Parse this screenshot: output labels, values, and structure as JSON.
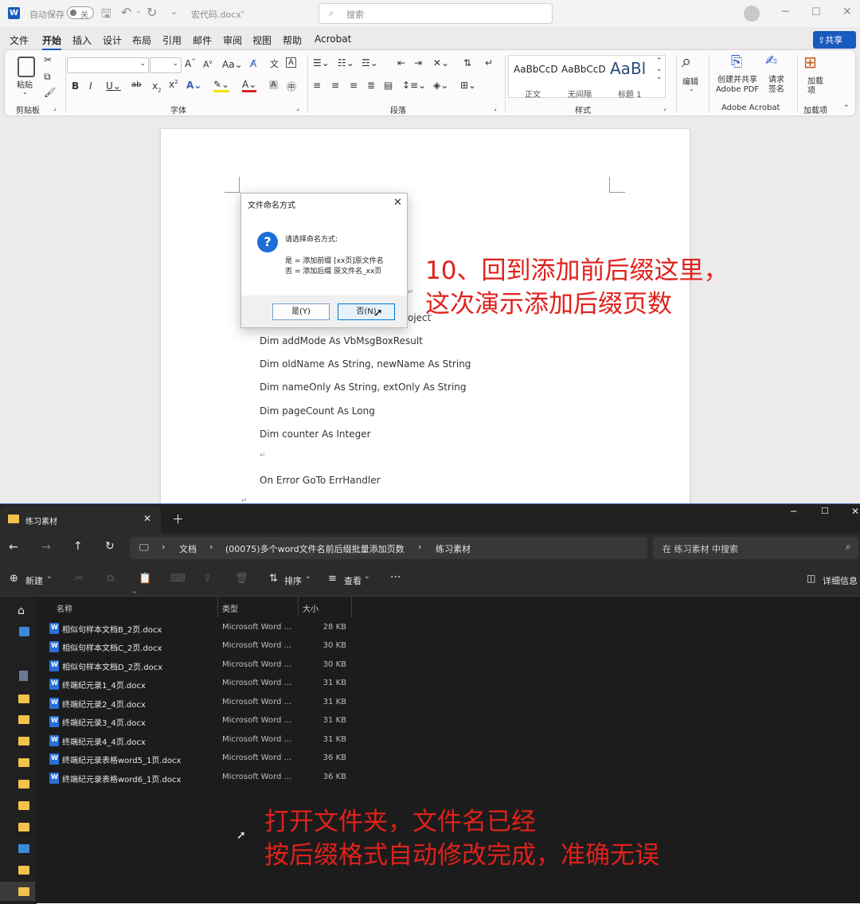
{
  "word": {
    "autosave_label": "自动保存",
    "autosave_state": "关",
    "doc_title": "宏代码.docx",
    "search_placeholder": "搜索",
    "menu": [
      "文件",
      "开始",
      "插入",
      "设计",
      "布局",
      "引用",
      "邮件",
      "审阅",
      "视图",
      "帮助",
      "Acrobat"
    ],
    "share_label": "共享",
    "ribbon": {
      "paste_label": "粘贴",
      "clipboard_label": "剪贴板",
      "font_label": "字体",
      "paragraph_label": "段落",
      "styles_label": "样式",
      "styles": [
        {
          "preview": "AaBbCcD",
          "name": "正文"
        },
        {
          "preview": "AaBbCcD",
          "name": "无间隔"
        },
        {
          "preview": "AaBl",
          "name": "标题 1"
        }
      ],
      "edit_label": "编辑",
      "create_pdf_label": "创建并共享 Adobe PDF",
      "sign_label": "请求签名",
      "adobe_label": "Adobe Acrobat",
      "addins_label": "加载项",
      "addins_icon_label": "加载项"
    },
    "code_lines": [
      "Dim addMode As VbMsgBoxResult",
      "Dim oldName As String, newName As String",
      "Dim nameOnly As String, extOnly As String",
      "Dim pageCount As Long",
      "Dim counter As Integer",
      "",
      "On Error GoTo ErrHandler"
    ],
    "code_partial": "oject"
  },
  "dialog": {
    "title": "文件命名方式",
    "prompt": "请选择命名方式:",
    "option_yes": "是 = 添加前缀 [xx页]原文件名",
    "option_no": "否 = 添加后缀 原文件名_xx页",
    "yes_button": "是(Y)",
    "no_button": "否(N)"
  },
  "annotations": {
    "top_line1": "10、回到添加前后缀这里，",
    "top_line2": "这次演示添加后缀页数",
    "bottom_line1": "打开文件夹，文件名已经",
    "bottom_line2": "按后缀格式自动修改完成，准确无误"
  },
  "explorer": {
    "tab_title": "练习素材",
    "breadcrumb": [
      "文档",
      "(00075)多个word文件名前后缀批量添加页数",
      "练习素材"
    ],
    "search_placeholder": "在 练习素材 中搜索",
    "new_label": "新建",
    "sort_label": "排序",
    "view_label": "查看",
    "details_label": "详细信息",
    "columns": {
      "name": "名称",
      "type": "类型",
      "size": "大小"
    },
    "files": [
      {
        "name": "相似句样本文档B_2页.docx",
        "type": "Microsoft Word ...",
        "size": "28 KB"
      },
      {
        "name": "相似句样本文档C_2页.docx",
        "type": "Microsoft Word ...",
        "size": "30 KB"
      },
      {
        "name": "相似句样本文档D_2页.docx",
        "type": "Microsoft Word ...",
        "size": "30 KB"
      },
      {
        "name": "终端纪元录1_4页.docx",
        "type": "Microsoft Word ...",
        "size": "31 KB"
      },
      {
        "name": "终端纪元录2_4页.docx",
        "type": "Microsoft Word ...",
        "size": "31 KB"
      },
      {
        "name": "终端纪元录3_4页.docx",
        "type": "Microsoft Word ...",
        "size": "31 KB"
      },
      {
        "name": "终端纪元录4_4页.docx",
        "type": "Microsoft Word ...",
        "size": "31 KB"
      },
      {
        "name": "终端纪元录表格word5_1页.docx",
        "type": "Microsoft Word ...",
        "size": "36 KB"
      },
      {
        "name": "终端纪元录表格word6_1页.docx",
        "type": "Microsoft Word ...",
        "size": "36 KB"
      }
    ]
  }
}
